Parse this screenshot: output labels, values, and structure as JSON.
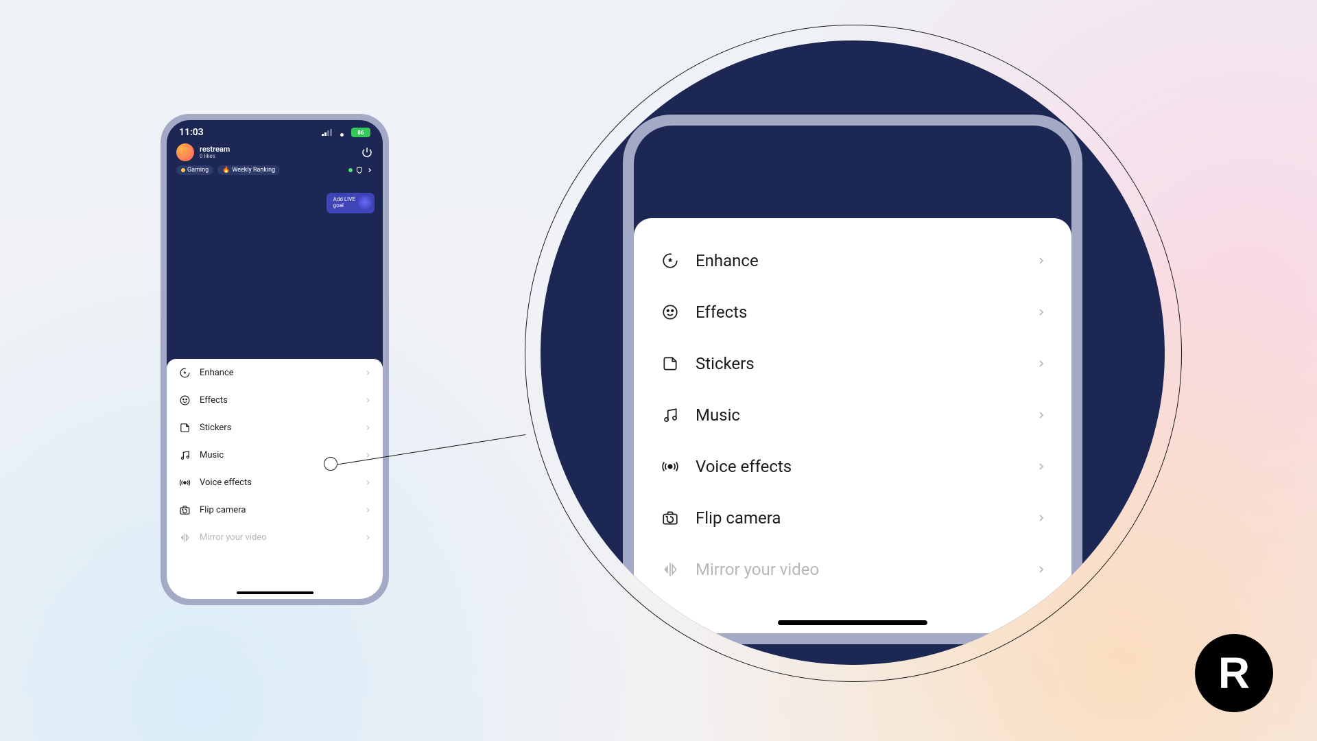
{
  "status": {
    "time": "11:03",
    "battery": "86"
  },
  "profile": {
    "username": "restream",
    "likes": "0 likes"
  },
  "chips": [
    "Gaming",
    "Weekly Ranking"
  ],
  "goal": {
    "line1": "Add LIVE",
    "line2": "goal"
  },
  "menu": [
    {
      "label": "Enhance",
      "dot": false
    },
    {
      "label": "Effects",
      "dot": false
    },
    {
      "label": "Stickers",
      "dot": true
    },
    {
      "label": "Music",
      "dot": true
    },
    {
      "label": "Voice effects",
      "dot": true
    },
    {
      "label": "Flip camera",
      "dot": false
    },
    {
      "label": "Mirror your video",
      "dot": false
    }
  ],
  "brand": "R",
  "colors": {
    "navy": "#1c2853",
    "frame": "#a4aac6",
    "accent": "#fe2c55"
  }
}
